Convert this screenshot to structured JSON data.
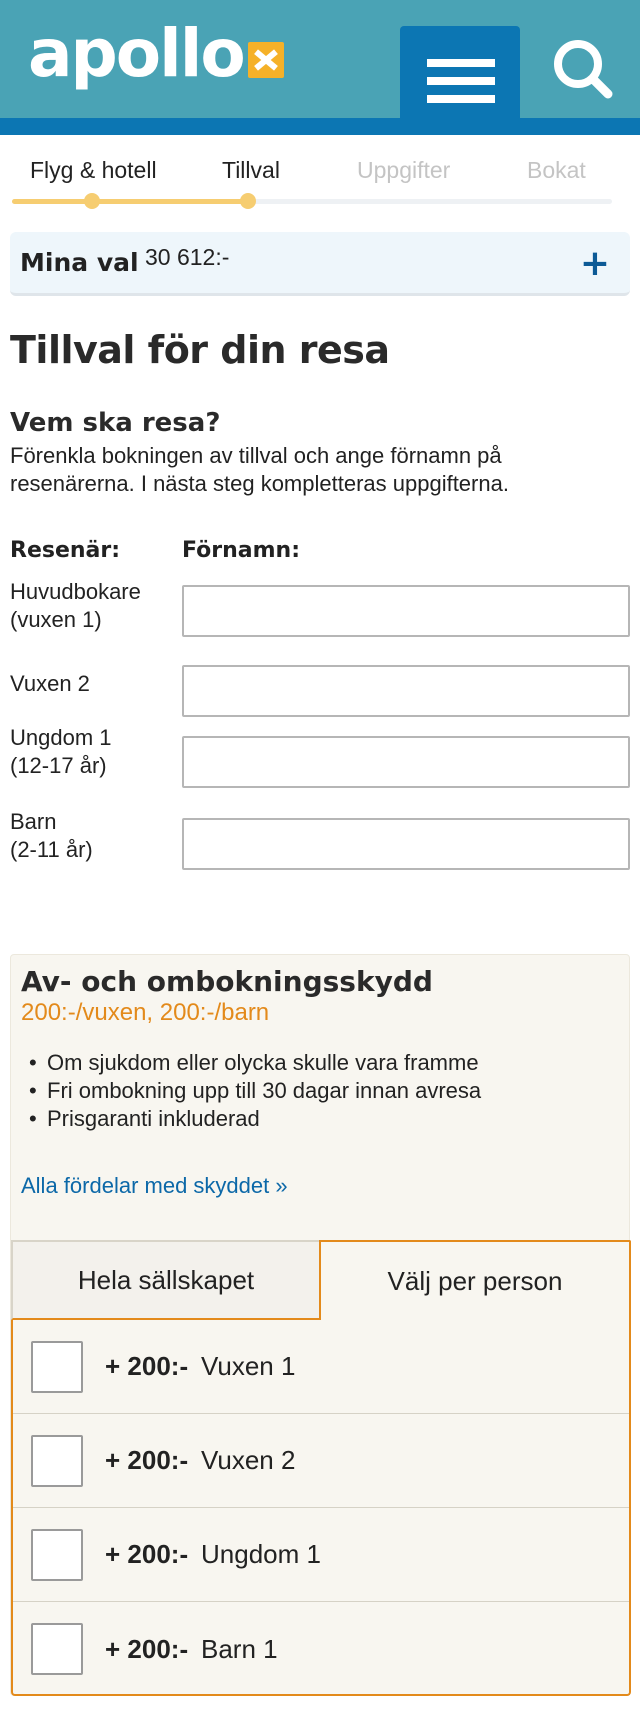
{
  "header": {
    "logo_text": "apollo",
    "menu_icon": "hamburger-menu-icon",
    "search_icon": "search-icon",
    "colors": {
      "bg": "#4aa3b5",
      "bar": "#0c76b3",
      "logo_accent": "#f5b128"
    }
  },
  "steps": {
    "items": [
      {
        "label": "Flyg & hotell",
        "state": "done"
      },
      {
        "label": "Tillval",
        "state": "current"
      },
      {
        "label": "Uppgifter",
        "state": "todo"
      },
      {
        "label": "Bokat",
        "state": "todo"
      }
    ],
    "progress_color": "#f6cd71"
  },
  "summary": {
    "label": "Mina val",
    "price": "30 612:-",
    "expand_icon": "plus-icon"
  },
  "page_title": "Tillval för din resa",
  "travelers": {
    "heading": "Vem ska resa?",
    "intro": "Förenkla bokningen av tillval och ange förnamn på resenärerna. I nästa steg kompletteras uppgifterna.",
    "col_traveler": "Resenär:",
    "col_firstname": "Förnamn:",
    "rows": [
      {
        "label": "Huvudbokare\n(vuxen 1)",
        "value": ""
      },
      {
        "label": "Vuxen 2",
        "value": ""
      },
      {
        "label": "Ungdom 1\n(12-17 år)",
        "value": ""
      },
      {
        "label": "Barn\n(2-11 år)",
        "value": ""
      }
    ]
  },
  "insurance": {
    "title": "Av- och ombokningsskydd",
    "price": "200:-/vuxen, 200:-/barn",
    "bullets": [
      "Om sjukdom eller olycka skulle vara framme",
      "Fri ombokning upp till 30 dagar innan avresa",
      "Prisgaranti inkluderad"
    ],
    "link": "Alla fördelar med skyddet »",
    "tabs": [
      {
        "label": "Hela sällskapet",
        "selected": false
      },
      {
        "label": "Välj per person",
        "selected": true
      }
    ],
    "options": [
      {
        "amount": "+ 200:-",
        "person": "Vuxen 1",
        "checked": false
      },
      {
        "amount": "+ 200:-",
        "person": "Vuxen 2",
        "checked": false
      },
      {
        "amount": "+ 200:-",
        "person": "Ungdom 1",
        "checked": false
      },
      {
        "amount": "+ 200:-",
        "person": "Barn 1",
        "checked": false
      }
    ],
    "accent_color": "#e38a1b"
  }
}
